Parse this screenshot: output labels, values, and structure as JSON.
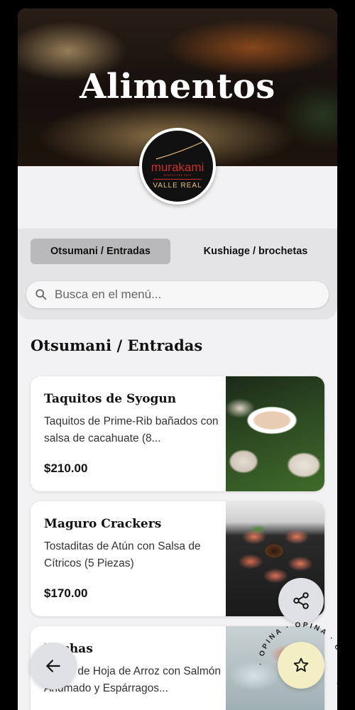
{
  "hero": {
    "title": "Alimentos"
  },
  "logo": {
    "brand": "murakami",
    "tagline": "SEARCH SEE SAVE",
    "subtitle": "VALLE REAL"
  },
  "tabs": [
    {
      "label": "Otsumani / Entradas",
      "active": true
    },
    {
      "label": "Kushiage / brochetas",
      "active": false
    }
  ],
  "search": {
    "placeholder": "Busca en el menú..."
  },
  "section": {
    "title": "Otsumani / Entradas"
  },
  "items": [
    {
      "name": "Taquitos de Syogun",
      "description": "Taquitos de Prime-Rib bañados con salsa de cacahuate (8...",
      "price": "$210.00"
    },
    {
      "name": "Maguro Crackers",
      "description": "Tostaditas de Atún con Salsa de Cítricos (5 Piezas)",
      "price": "$170.00"
    },
    {
      "name": "Rochas",
      "description": "Rollos de Hoja de Arroz con Salmón Ahumado y Espárragos...",
      "price": ""
    }
  ],
  "badge": {
    "ring_text": "· OPINA · OPINA · OPINA ·"
  },
  "icons": {
    "search": "search-icon",
    "share": "share-icon",
    "back": "arrow-left-icon",
    "star": "star-icon"
  },
  "colors": {
    "background": "#f2f2f4",
    "tab_active": "#b9b9bb",
    "tabs_panel": "#e4e4e6",
    "brand_red": "#c9302c",
    "star_button": "#f3eec4",
    "fab": "#dfe1e4"
  }
}
